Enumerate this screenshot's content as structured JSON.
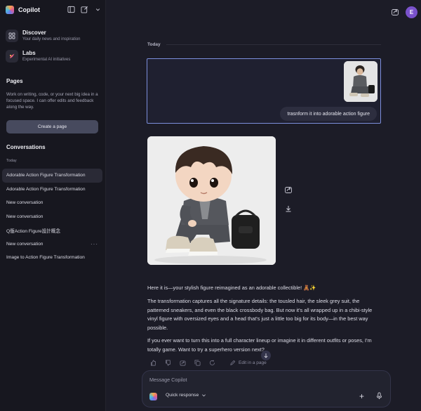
{
  "app": {
    "name": "Copilot"
  },
  "sidebar": {
    "discover": {
      "title": "Discover",
      "subtitle": "Your daily news and inspiration"
    },
    "labs": {
      "title": "Labs",
      "subtitle": "Experimental AI initiatives"
    },
    "pages": {
      "heading": "Pages",
      "description": "Work on writing, code, or your next big idea in a focused space. I can offer edits and feedback along the way.",
      "create_label": "Create a page"
    },
    "conversations": {
      "heading": "Conversations",
      "today_label": "Today",
      "items": [
        {
          "label": "Adorable Action Figure Transformation",
          "active": true
        },
        {
          "label": "Adorable Action Figure Transformation"
        },
        {
          "label": "New conversation"
        },
        {
          "label": "New conversation"
        },
        {
          "label": "Q版Action Figure設計概念"
        },
        {
          "label": "New conversation",
          "more": "···"
        },
        {
          "label": "Image to Action Figure Transformation"
        }
      ]
    }
  },
  "header": {
    "avatar_initial": "E"
  },
  "chat": {
    "day_label": "Today",
    "user_message": "trasnform it into adorable action figure",
    "response": {
      "p1": "Here it is—your stylish figure reimagined as an adorable collectible! 🧸✨",
      "p2": "The transformation captures all the signature details: the tousled hair, the sleek grey suit, the patterned sneakers, and even the black crossbody bag. But now it's all wrapped up in a chibi-style vinyl figure with oversized eyes and a head that's just a little too big for its body—in the best way possible.",
      "p3": "If you ever want to turn this into a full character lineup or imagine it in different outfits or poses, I'm totally game. Want to try a superhero version next?"
    },
    "edit_in_page": "Edit in a page"
  },
  "composer": {
    "placeholder": "Message Copilot",
    "mode_label": "Quick response"
  },
  "colors": {
    "accent": "#7c8fdc",
    "avatar": "#7a52cc",
    "background": "#1c1c27",
    "sidebar": "#17171f"
  }
}
